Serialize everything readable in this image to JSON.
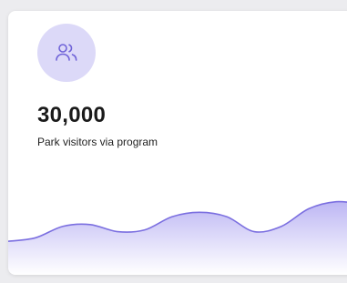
{
  "card": {
    "icon": "users-icon",
    "value": "30,000",
    "label": "Park visitors via program"
  },
  "colors": {
    "accent": "#7b6fe0",
    "icon_bg": "#dcd9f8",
    "area_fill": "#c8c2f5"
  },
  "sparkline": {
    "values": [
      5,
      9,
      22,
      24,
      16,
      18,
      33,
      38,
      33,
      16,
      22,
      42,
      50,
      47
    ]
  }
}
